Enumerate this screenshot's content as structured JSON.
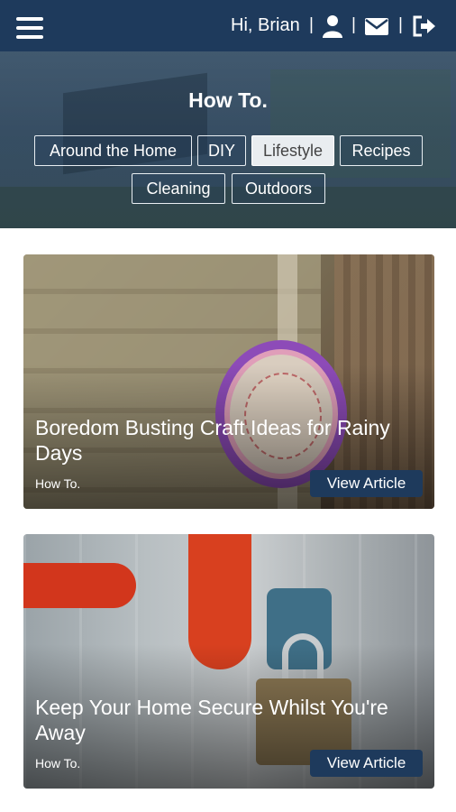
{
  "header": {
    "menu_icon": "hamburger-menu-icon",
    "greeting": "Hi, Brian",
    "separator": "|",
    "icons": [
      "user-icon",
      "mail-icon",
      "logout-icon"
    ]
  },
  "hero": {
    "title": "How To.",
    "categories": [
      {
        "label": "Around the Home",
        "active": false
      },
      {
        "label": "DIY",
        "active": false
      },
      {
        "label": "Lifestyle",
        "active": true
      },
      {
        "label": "Recipes",
        "active": false
      },
      {
        "label": "Cleaning",
        "active": false
      },
      {
        "label": "Outdoors",
        "active": false
      }
    ]
  },
  "articles": [
    {
      "title": "Boredom Busting Craft Ideas for Rainy Days",
      "category": "How To.",
      "button": "View Article"
    },
    {
      "title": "Keep Your Home Secure Whilst You're Away",
      "category": "How To.",
      "button": "View Article"
    }
  ],
  "colors": {
    "primary": "#1e3a5c",
    "chip_active": "#e9edf0"
  }
}
